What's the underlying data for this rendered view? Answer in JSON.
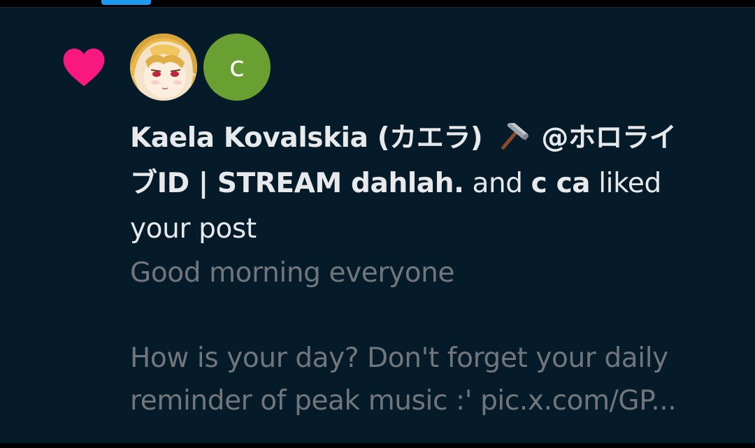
{
  "colors": {
    "background": "#051b2a",
    "accent_blue": "#1d9bf0",
    "heart": "#f91880",
    "primary_text": "#e7e9ea",
    "secondary_text": "#71767b",
    "avatar_c_bg": "#6a9f32"
  },
  "icons": {
    "like": "heart-icon",
    "emoji": "hammer-icon"
  },
  "notification": {
    "avatars": [
      {
        "kind": "image",
        "alt": "Kaela Kovalskia avatar"
      },
      {
        "kind": "letter",
        "letter": "c"
      }
    ],
    "user1_name": "Kaela Kovalskia (カエラ)",
    "user1_handle_line1": "@ホロライ",
    "user1_handle_line2": "ブID | STREAM dahlah.",
    "connector": "and",
    "user2_name": "c ca",
    "action": "liked",
    "object": "your post",
    "post_line1": "Good morning everyone",
    "post_line2": "How is your day? Don't forget your daily",
    "post_line3": "reminder of peak music :' pic.x.com/GP..."
  }
}
